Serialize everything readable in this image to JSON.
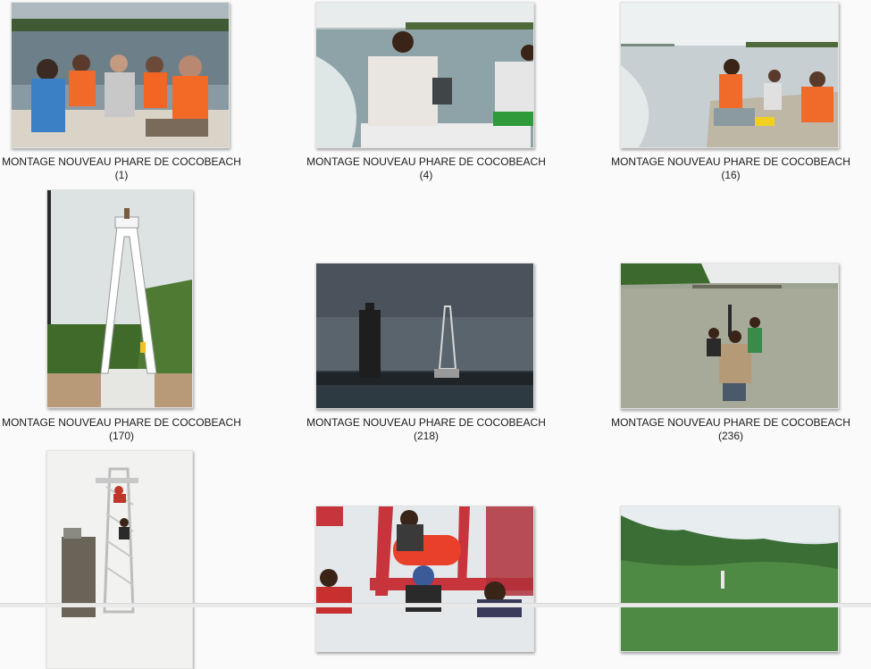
{
  "gallery": {
    "items": [
      {
        "title": "MONTAGE NOUVEAU PHARE DE COCOBEACH",
        "number": "(1)"
      },
      {
        "title": "MONTAGE NOUVEAU PHARE DE COCOBEACH",
        "number": "(4)"
      },
      {
        "title": "MONTAGE NOUVEAU PHARE DE COCOBEACH",
        "number": "(16)"
      },
      {
        "title": "MONTAGE NOUVEAU PHARE DE COCOBEACH",
        "number": "(170)"
      },
      {
        "title": "MONTAGE NOUVEAU PHARE DE COCOBEACH",
        "number": "(218)"
      },
      {
        "title": "MONTAGE NOUVEAU PHARE DE COCOBEACH",
        "number": "(236)"
      },
      {
        "title": "",
        "number": ""
      },
      {
        "title": "",
        "number": ""
      },
      {
        "title": "",
        "number": ""
      }
    ]
  }
}
